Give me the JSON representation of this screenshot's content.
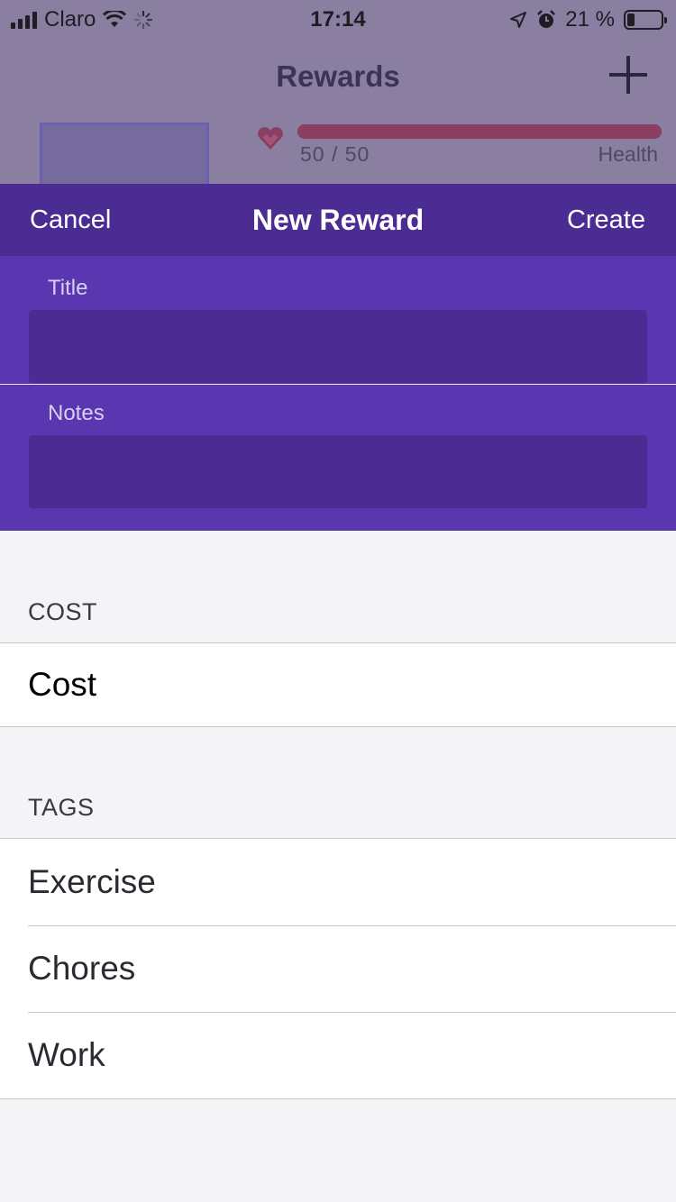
{
  "status_bar": {
    "carrier": "Claro",
    "time": "17:14",
    "battery_percent": "21 %",
    "battery_level": 0.21
  },
  "background": {
    "title": "Rewards",
    "health_value": "50 / 50",
    "health_label": "Health",
    "health_fraction": 1.0
  },
  "modal": {
    "cancel_label": "Cancel",
    "title": "New Reward",
    "create_label": "Create",
    "title_field_label": "Title",
    "title_field_value": "",
    "notes_field_label": "Notes",
    "notes_field_value": ""
  },
  "cost_section": {
    "header": "COST",
    "row_label": "Cost"
  },
  "tags_section": {
    "header": "TAGS",
    "tags": [
      "Exercise",
      "Chores",
      "Work"
    ]
  },
  "colors": {
    "nav": "#4a2c92",
    "form": "#5a36b0",
    "input": "#4a2c92",
    "health": "#8a3f62"
  }
}
